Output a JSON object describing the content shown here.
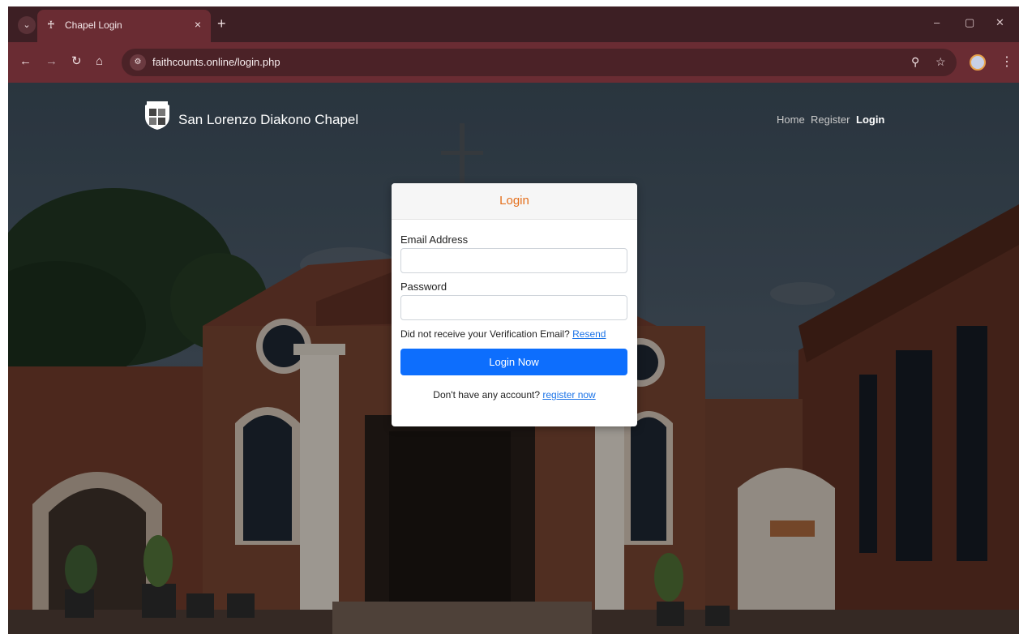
{
  "browser": {
    "tab_title": "Chapel Login",
    "tab_close": "×",
    "new_tab": "+",
    "url": "faithcounts.online/login.php",
    "window_controls": {
      "minimize": "–",
      "restore": "▢",
      "close": "✕"
    }
  },
  "header": {
    "brand": "San Lorenzo Diakono Chapel",
    "nav": [
      {
        "label": "Home"
      },
      {
        "label": "Register"
      },
      {
        "label": "Login"
      }
    ]
  },
  "login": {
    "title": "Login",
    "email_label": "Email Address",
    "email_value": "",
    "password_label": "Password",
    "password_value": "",
    "verify_text": "Did not receive your Verification Email?",
    "resend_link": "Resend",
    "submit_label": "Login Now",
    "no_account_text": "Don't have any account?",
    "register_link": "register now"
  },
  "colors": {
    "browser_frame": "#6a2c33",
    "card_title": "#e46f1c",
    "primary_button": "#0d6efd",
    "link": "#1a73e8"
  },
  "icons": [
    "tab-search-icon",
    "chapel-favicon-icon",
    "back-icon",
    "forward-icon",
    "reload-icon",
    "home-icon",
    "site-info-icon",
    "zoom-icon",
    "bookmark-star-icon",
    "profile-avatar",
    "menu-kebab-icon",
    "chapel-logo"
  ]
}
